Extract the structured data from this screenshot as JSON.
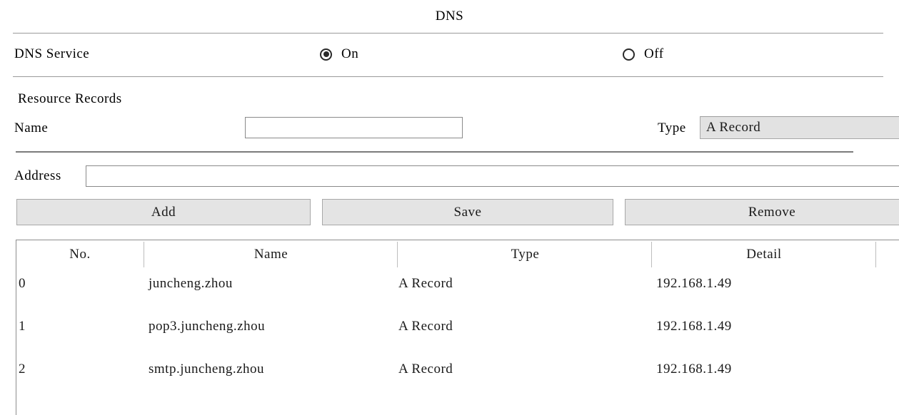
{
  "page": {
    "title": "DNS"
  },
  "service": {
    "label": "DNS Service",
    "options": [
      {
        "label": "On",
        "selected": true
      },
      {
        "label": "Off",
        "selected": false
      }
    ]
  },
  "resource_records": {
    "heading": "Resource Records",
    "name_field": {
      "label": "Name",
      "value": "",
      "placeholder": ""
    },
    "type_field": {
      "label": "Type",
      "selected": "A Record",
      "options": [
        "A Record"
      ]
    },
    "address_field": {
      "label": "Address",
      "value": "",
      "placeholder": ""
    }
  },
  "buttons": {
    "add": "Add",
    "save": "Save",
    "remove": "Remove"
  },
  "table": {
    "columns": [
      "No.",
      "Name",
      "Type",
      "Detail"
    ],
    "rows": [
      {
        "no": "0",
        "name": "juncheng.zhou",
        "type": "A Record",
        "detail": "192.168.1.49"
      },
      {
        "no": "1",
        "name": "pop3.juncheng.zhou",
        "type": "A Record",
        "detail": "192.168.1.49"
      },
      {
        "no": "2",
        "name": "smtp.juncheng.zhou",
        "type": "A Record",
        "detail": "192.168.1.49"
      }
    ]
  },
  "colors": {
    "background": "#ffffff",
    "text": "#000000",
    "control_fill": "#e4e4e4",
    "border": "#8d8d8d",
    "rule": "#9a9a9a"
  }
}
